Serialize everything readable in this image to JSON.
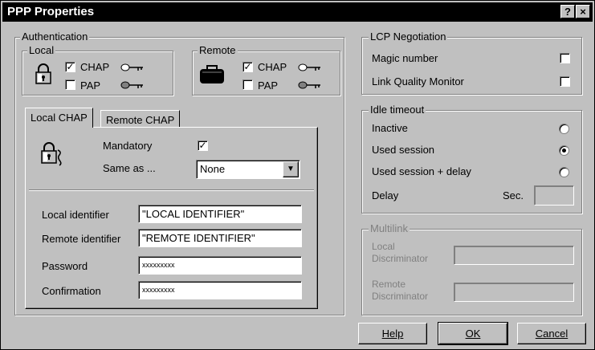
{
  "window": {
    "title": "PPP Properties",
    "help_button": "?",
    "close_button": "×"
  },
  "authentication": {
    "label": "Authentication",
    "local": {
      "label": "Local",
      "chap": "CHAP",
      "pap": "PAP",
      "chap_checked": true,
      "pap_checked": false
    },
    "remote": {
      "label": "Remote",
      "chap": "CHAP",
      "pap": "PAP",
      "chap_checked": true,
      "pap_checked": false
    },
    "tabs": [
      {
        "label": "Local CHAP",
        "active": true
      },
      {
        "label": "Remote CHAP",
        "active": false
      }
    ],
    "mandatory": {
      "label": "Mandatory",
      "checked": true
    },
    "same_as": {
      "label": "Same as ...",
      "value": "None"
    },
    "local_identifier": {
      "label": "Local identifier",
      "value": "\"LOCAL IDENTIFIER\""
    },
    "remote_identifier": {
      "label": "Remote identifier",
      "value": "\"REMOTE IDENTIFIER\""
    },
    "password": {
      "label": "Password",
      "value": "xxxxxxxxx"
    },
    "confirmation": {
      "label": "Confirmation",
      "value": "xxxxxxxxx"
    }
  },
  "lcp": {
    "label": "LCP Negotiation",
    "magic_number": {
      "label": "Magic number",
      "checked": false
    },
    "link_quality": {
      "label": "Link Quality Monitor",
      "checked": false
    }
  },
  "idle": {
    "label": "Idle timeout",
    "options": [
      {
        "label": "Inactive",
        "selected": false
      },
      {
        "label": "Used session",
        "selected": true
      },
      {
        "label": "Used session + delay",
        "selected": false
      }
    ],
    "delay": {
      "label": "Delay",
      "unit": "Sec.",
      "value": ""
    }
  },
  "multilink": {
    "label": "Multilink",
    "local_disc": {
      "label_line1": "Local",
      "label_line2": "Discriminator",
      "value": ""
    },
    "remote_disc": {
      "label_line1": "Remote",
      "label_line2": "Discriminator",
      "value": ""
    }
  },
  "buttons": {
    "help": "Help",
    "ok": "OK",
    "cancel": "Cancel"
  }
}
